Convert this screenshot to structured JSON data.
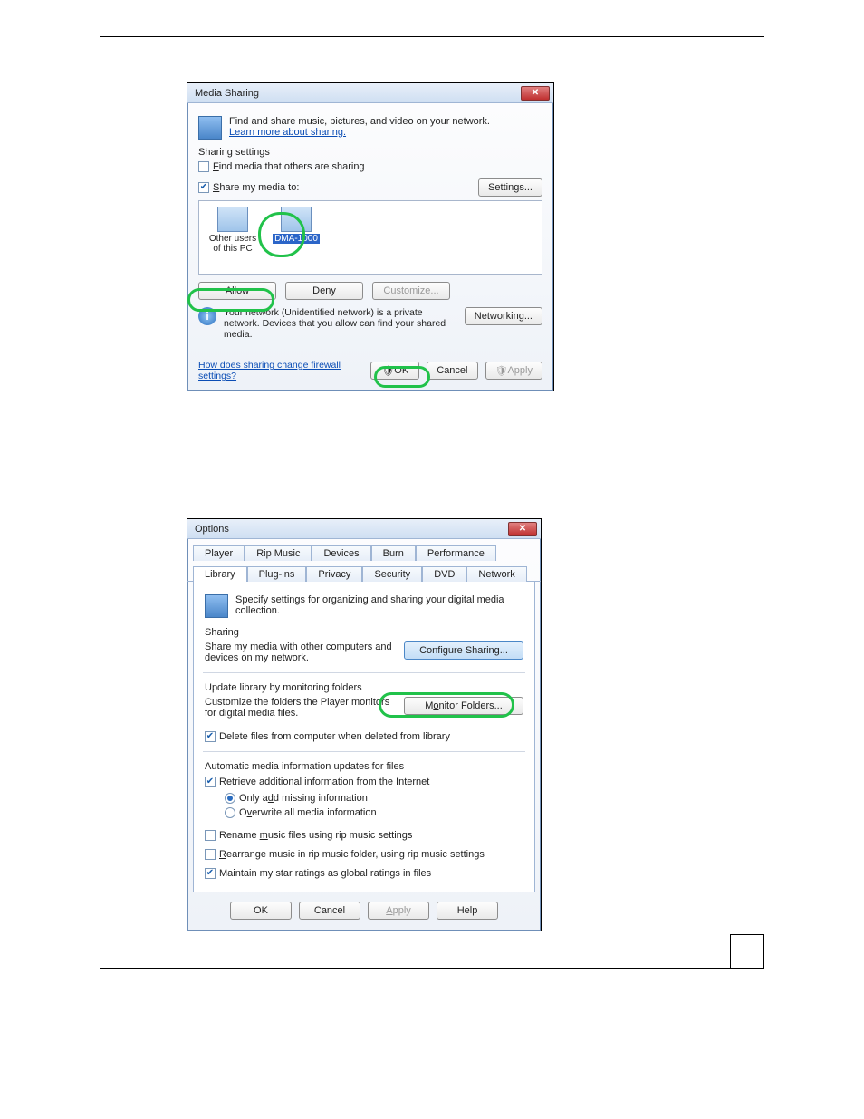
{
  "dialog1": {
    "title": "Media Sharing",
    "intro": "Find and share music, pictures, and video on your network.",
    "intro_link": "Learn more about sharing.",
    "sharing_settings_label": "Sharing settings",
    "find_media": "Find media that others are sharing",
    "share_my_media_to": "Share my media to:",
    "settings_btn": "Settings...",
    "devices": [
      {
        "label": "Other users of this PC"
      },
      {
        "label": "DMA-1000"
      }
    ],
    "allow_btn": "Allow",
    "deny_btn": "Deny",
    "customize_btn": "Customize...",
    "info_text": "Your network (Unidentified network) is a private network. Devices that you allow can find your shared media.",
    "networking_btn": "Networking...",
    "firewall_link": "How does sharing change firewall settings?",
    "ok_btn": "OK",
    "cancel_btn": "Cancel",
    "apply_btn": "Apply"
  },
  "dialog2": {
    "title": "Options",
    "tabs_row1": [
      "Player",
      "Rip Music",
      "Devices",
      "Burn",
      "Performance"
    ],
    "tabs_row2": [
      "Library",
      "Plug-ins",
      "Privacy",
      "Security",
      "DVD",
      "Network"
    ],
    "intro": "Specify settings for organizing and sharing your digital media collection.",
    "sharing_label": "Sharing",
    "sharing_text": "Share my media with other computers and devices on my network.",
    "configure_sharing_btn": "Configure Sharing...",
    "update_label": "Update library by monitoring folders",
    "monitor_text": "Customize the folders the Player monitors for digital media files.",
    "monitor_btn": "Monitor Folders...",
    "delete_files": "Delete files from computer when deleted from library",
    "auto_media_label": "Automatic media information updates for files",
    "retrieve_internet": "Retrieve additional information from the Internet",
    "only_add_missing": "Only add missing information",
    "overwrite_all": "Overwrite all media information",
    "rename_music": "Rename music files using rip music settings",
    "rearrange_music": "Rearrange music in rip music folder, using rip music settings",
    "maintain_ratings": "Maintain my star ratings as global ratings in files",
    "ok_btn": "OK",
    "cancel_btn": "Cancel",
    "apply_btn": "Apply",
    "help_btn": "Help"
  }
}
